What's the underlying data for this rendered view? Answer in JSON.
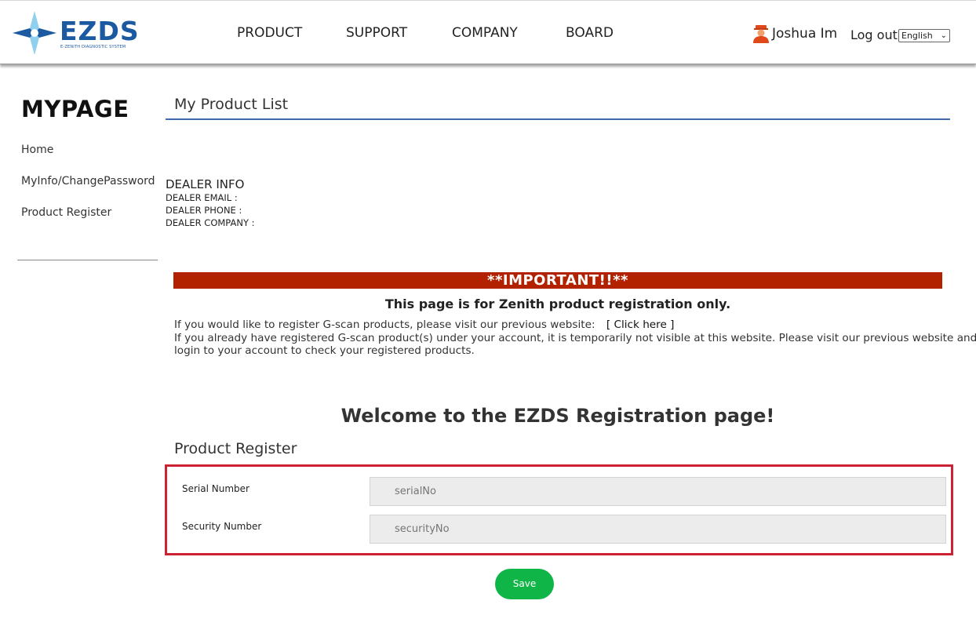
{
  "header": {
    "logo_text": "EZDS",
    "logo_subtitle": "E-ZENITH DIAGNOSTIC SYSTEM",
    "nav": [
      "PRODUCT",
      "SUPPORT",
      "COMPANY",
      "BOARD"
    ],
    "user_name": "Joshua Im",
    "logout_label": "Log out",
    "language": "English"
  },
  "sidebar": {
    "title": "MYPAGE",
    "items": [
      "Home",
      "MyInfo/ChangePassword",
      "Product Register"
    ]
  },
  "main": {
    "list_title": "My Product List",
    "dealer": {
      "title": "DEALER INFO",
      "email_label": "DEALER EMAIL :",
      "phone_label": "DEALER PHONE :",
      "company_label": "DEALER COMPANY :"
    },
    "notice": {
      "banner": "**IMPORTANT!!**",
      "headline": "This page is for Zenith product registration only.",
      "line1": "If you would like to register G-scan products, please visit our previous website:",
      "link": "[ Click here ]",
      "line2": "If you already have registered G-scan product(s) under your account, it is temporarily not visible at this website. Please visit our previous website and",
      "line3": "login to your account to check your registered products."
    },
    "welcome": "Welcome to the EZDS Registration page!",
    "register_title": "Product Register",
    "form": {
      "serial_label": "Serial Number",
      "serial_placeholder": "serialNo",
      "security_label": "Security Number",
      "security_placeholder": "securityNo"
    },
    "save_label": "Save"
  },
  "colors": {
    "brand": "#1b5aa0",
    "banner": "#b22200",
    "save": "#10b548",
    "highlight_border": "#cc2233"
  }
}
